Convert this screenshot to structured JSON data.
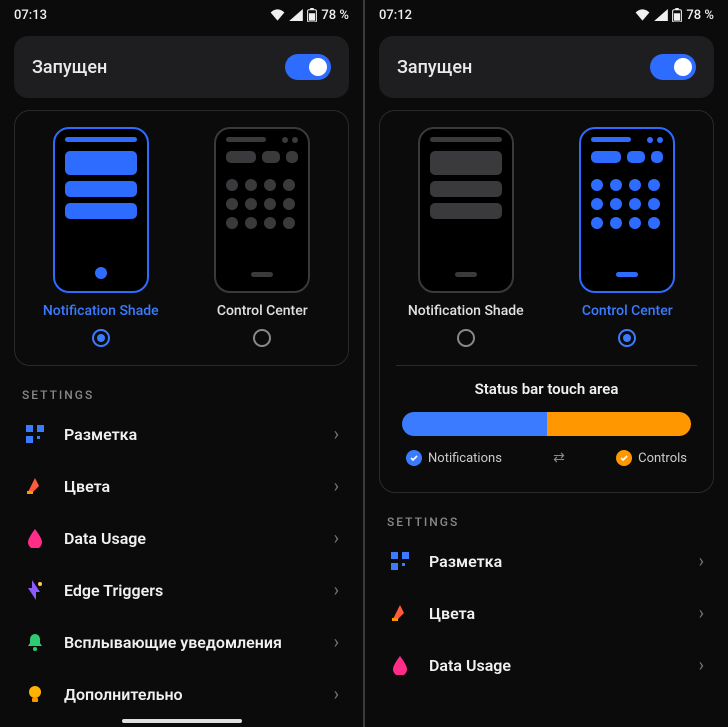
{
  "left": {
    "status": {
      "time": "07:13",
      "battery": "78 %"
    },
    "header": {
      "title": "Запущен"
    },
    "modes": {
      "notification": "Notification Shade",
      "control": "Control Center",
      "selected": "notification"
    },
    "section_label": "SETTINGS",
    "settings": [
      {
        "name": "layout",
        "label": "Разметка",
        "icon": "grid"
      },
      {
        "name": "colors",
        "label": "Цвета",
        "icon": "palette"
      },
      {
        "name": "data-usage",
        "label": "Data Usage",
        "icon": "drop"
      },
      {
        "name": "edge-triggers",
        "label": "Edge Triggers",
        "icon": "spark"
      },
      {
        "name": "popup-notifs",
        "label": "Всплывающие уведомления",
        "icon": "bell"
      },
      {
        "name": "more",
        "label": "Дополнительно",
        "icon": "bulb"
      }
    ]
  },
  "right": {
    "status": {
      "time": "07:12",
      "battery": "78 %"
    },
    "header": {
      "title": "Запущен"
    },
    "modes": {
      "notification": "Notification Shade",
      "control": "Control Center",
      "selected": "control"
    },
    "touch_area": {
      "title": "Status bar touch area",
      "notifications": "Notifications",
      "controls": "Controls"
    },
    "section_label": "SETTINGS",
    "settings": [
      {
        "name": "layout",
        "label": "Разметка",
        "icon": "grid"
      },
      {
        "name": "colors",
        "label": "Цвета",
        "icon": "palette"
      },
      {
        "name": "data-usage",
        "label": "Data Usage",
        "icon": "drop"
      }
    ]
  },
  "colors": {
    "accent": "#3a7bff",
    "warn": "#ff9800"
  }
}
